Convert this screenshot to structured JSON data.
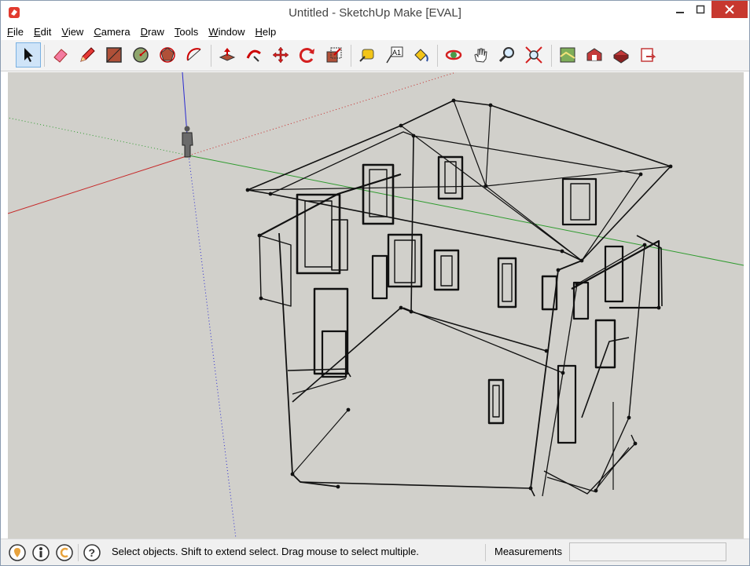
{
  "window": {
    "title": "Untitled - SketchUp Make [EVAL]",
    "app_icon": "sketchup-logo-icon",
    "controls": [
      "minimize-icon",
      "maximize-icon",
      "close-icon"
    ]
  },
  "menu": [
    {
      "label": "File",
      "accel": "F",
      "rest": "ile"
    },
    {
      "label": "Edit",
      "accel": "E",
      "rest": "dit"
    },
    {
      "label": "View",
      "accel": "V",
      "rest": "iew"
    },
    {
      "label": "Camera",
      "accel": "C",
      "rest": "amera"
    },
    {
      "label": "Draw",
      "accel": "D",
      "rest": "raw"
    },
    {
      "label": "Tools",
      "accel": "T",
      "rest": "ools"
    },
    {
      "label": "Window",
      "accel": "W",
      "rest": "indow"
    },
    {
      "label": "Help",
      "accel": "H",
      "rest": "elp"
    }
  ],
  "toolbar": {
    "tools": [
      "select-icon",
      "eraser-icon",
      "pencil-icon",
      "rectangle-icon",
      "circle-icon",
      "polygon-icon",
      "arc-icon",
      "push-pull-icon",
      "follow-me-icon",
      "move-icon",
      "rotate-icon",
      "scale-icon",
      "tape-measure-icon",
      "text-icon",
      "paint-bucket-icon",
      "orbit-icon",
      "pan-icon",
      "zoom-icon",
      "zoom-extents-icon",
      "map-icon",
      "warehouse-icon",
      "extension-warehouse-icon",
      "share-model-icon"
    ],
    "selected": "select-icon",
    "text_tool_glyph": "A1"
  },
  "viewport": {
    "background": "#d1d0cb",
    "axis_colors": {
      "red": "#c62828",
      "green": "#2e9b2e",
      "blue": "#2a2ad0"
    }
  },
  "status": {
    "icons": [
      "geo-location-icon",
      "credits-icon",
      "sign-in-icon"
    ],
    "help_icon": "help-icon",
    "message": "Select objects. Shift to extend select. Drag mouse to select multiple.",
    "measurements_label": "Measurements",
    "measurements_value": ""
  }
}
